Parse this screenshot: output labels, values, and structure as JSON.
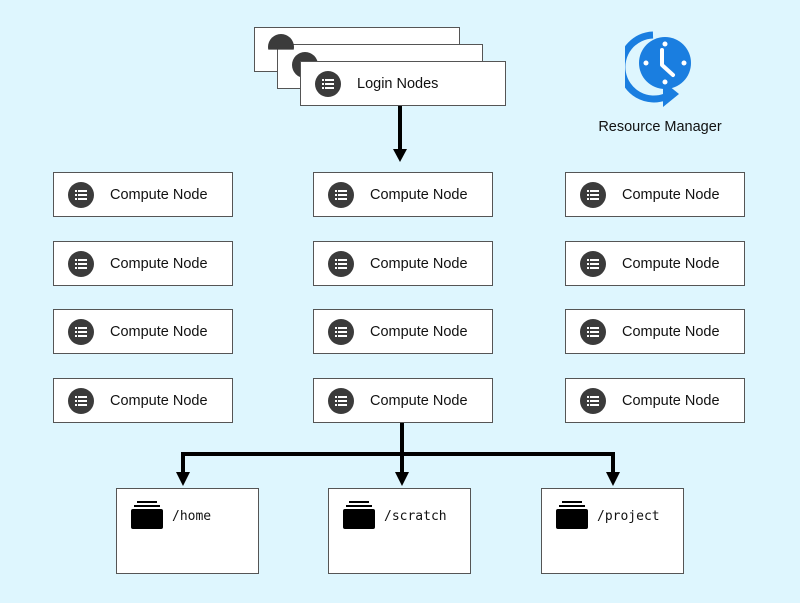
{
  "login": {
    "label": "Login Nodes",
    "icon": "list-icon"
  },
  "resource_manager": {
    "label": "Resource Manager",
    "icon": "clock-cycle-icon",
    "color": "#1a7ee0"
  },
  "compute_nodes": {
    "label": "Compute Node",
    "columns": [
      [
        "Compute Node",
        "Compute Node",
        "Compute Node",
        "Compute Node"
      ],
      [
        "Compute Node",
        "Compute Node",
        "Compute Node",
        "Compute Node"
      ],
      [
        "Compute Node",
        "Compute Node",
        "Compute Node",
        "Compute Node"
      ]
    ]
  },
  "storage": [
    {
      "path": "/home",
      "icon": "folder-stack-icon"
    },
    {
      "path": "/scratch",
      "icon": "folder-stack-icon"
    },
    {
      "path": "/project",
      "icon": "folder-stack-icon"
    }
  ],
  "colors": {
    "background": "#def6fe",
    "icon_bg": "#3b3b3b",
    "arrow": "#000000"
  }
}
